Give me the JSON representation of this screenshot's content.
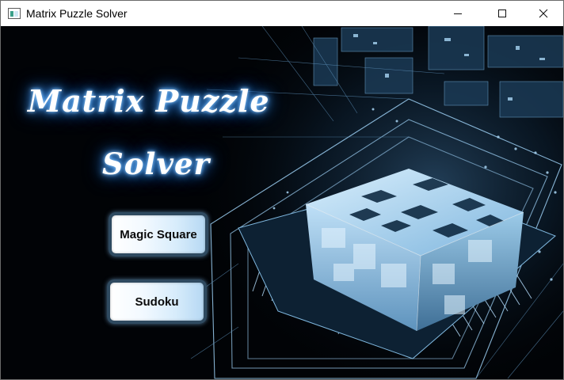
{
  "window": {
    "title": "Matrix Puzzle Solver",
    "icon": "window-app-icon",
    "controls": {
      "minimize": "minimize-icon",
      "maximize": "maximize-icon",
      "close": "close-icon"
    }
  },
  "main": {
    "title_line1": "Matrix Puzzle",
    "title_line2": "Solver",
    "buttons": {
      "magic_square": "Magic Square",
      "sudoku": "Sudoku"
    }
  },
  "colors": {
    "title_glow": "#4fa8ff",
    "background": "#010306",
    "circuit": "#9fd0ff",
    "button_border": "#2f4a60"
  }
}
